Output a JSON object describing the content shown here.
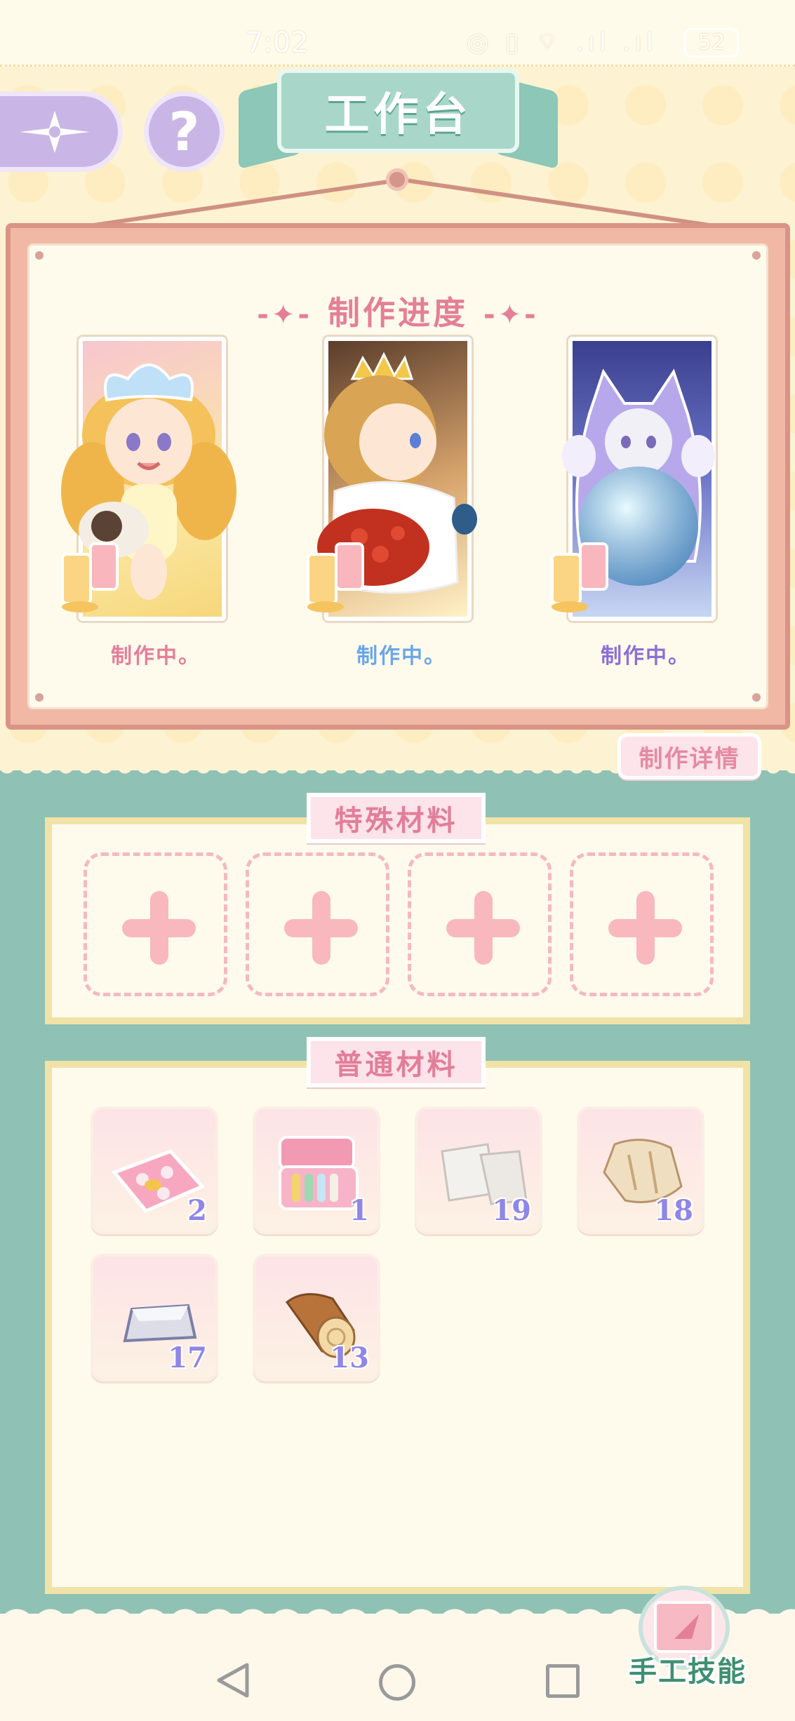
{
  "status_bar": {
    "time": "7:02",
    "icons": "◎ ▯ ⌔ .ıl .ıl",
    "battery": "52"
  },
  "header": {
    "title": "工作台",
    "back_icon": "compass-star-icon",
    "help_label": "?"
  },
  "progress": {
    "title": "制作进度",
    "cards": [
      {
        "status": "制作中。",
        "status_color": "#e67d9a"
      },
      {
        "status": "制作中。",
        "status_color": "#6aa6ea"
      },
      {
        "status": "制作中。",
        "status_color": "#8d6fd6"
      }
    ],
    "details_label": "制作详情"
  },
  "special_materials": {
    "title": "特殊材料",
    "slots": [
      "plus-icon",
      "plus-icon",
      "plus-icon",
      "plus-icon"
    ]
  },
  "normal_materials": {
    "title": "普通材料",
    "items": [
      {
        "icon": "pink-cloth-icon",
        "count": "2"
      },
      {
        "icon": "sewing-box-icon",
        "count": "1"
      },
      {
        "icon": "white-fabric-icon",
        "count": "19"
      },
      {
        "icon": "fur-pelt-icon",
        "count": "18"
      },
      {
        "icon": "silver-ingot-icon",
        "count": "17"
      },
      {
        "icon": "wood-log-icon",
        "count": "13"
      }
    ]
  },
  "skill_button": {
    "label": "手工技能"
  },
  "colors": {
    "accent_pink": "#e47f97",
    "teal": "#8fc2b4",
    "count_purple": "#8f86e5"
  }
}
